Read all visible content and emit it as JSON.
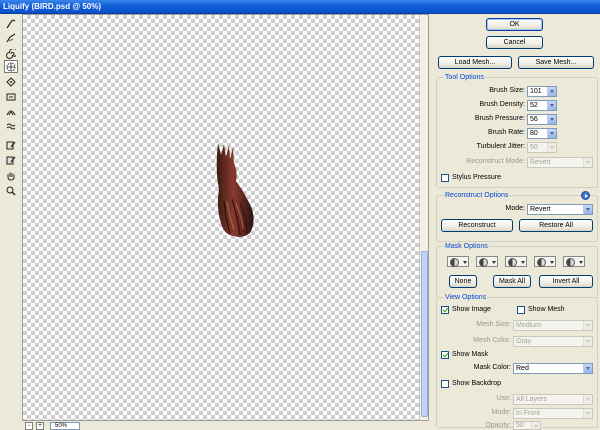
{
  "window": {
    "title": "Liquify (BIRD.psd @ 50%)"
  },
  "tools": [
    {
      "name": "forward-warp-tool"
    },
    {
      "name": "reconstruct-tool"
    },
    {
      "name": "twirl-tool"
    },
    {
      "name": "pucker-tool"
    },
    {
      "name": "bloat-tool"
    },
    {
      "name": "push-left-tool"
    },
    {
      "name": "mirror-tool"
    },
    {
      "name": "turbulence-tool"
    },
    {
      "name": "freeze-mask-tool"
    },
    {
      "name": "thaw-mask-tool"
    },
    {
      "name": "hand-tool"
    },
    {
      "name": "zoom-tool"
    }
  ],
  "canvas": {
    "zoom_value": "50%",
    "zoom_out": "-",
    "zoom_in": "+"
  },
  "buttons": {
    "ok": "OK",
    "cancel": "Cancel",
    "load_mesh": "Load Mesh...",
    "save_mesh": "Save Mesh..."
  },
  "tool_options": {
    "title": "Tool Options",
    "brush_size_label": "Brush Size:",
    "brush_size": "101",
    "brush_density_label": "Brush Density:",
    "brush_density": "52",
    "brush_pressure_label": "Brush Pressure:",
    "brush_pressure": "56",
    "brush_rate_label": "Brush Rate:",
    "brush_rate": "80",
    "turbulent_jitter_label": "Turbulent Jitter:",
    "turbulent_jitter": "50",
    "reconstruct_mode_label": "Reconstruct Mode:",
    "reconstruct_mode": "Revert",
    "stylus_pressure_label": "Stylus Pressure"
  },
  "reconstruct_options": {
    "title": "Reconstruct Options",
    "mode_label": "Mode:",
    "mode": "Revert",
    "reconstruct": "Reconstruct",
    "restore_all": "Restore All"
  },
  "mask_options": {
    "title": "Mask Options",
    "none": "None",
    "mask_all": "Mask All",
    "invert_all": "Invert All"
  },
  "view_options": {
    "title": "View Options",
    "show_image": "Show Image",
    "show_mesh": "Show Mesh",
    "mesh_size_label": "Mesh Size:",
    "mesh_size": "Medium",
    "mesh_color_label": "Mesh Color:",
    "mesh_color": "Gray",
    "show_mask": "Show Mask",
    "mask_color_label": "Mask Color:",
    "mask_color": "Red",
    "show_backdrop": "Show Backdrop",
    "use_label": "Use:",
    "use": "All Layers",
    "mode_label": "Mode:",
    "mode": "In Front",
    "opacity_label": "Opacity:",
    "opacity": "50"
  }
}
